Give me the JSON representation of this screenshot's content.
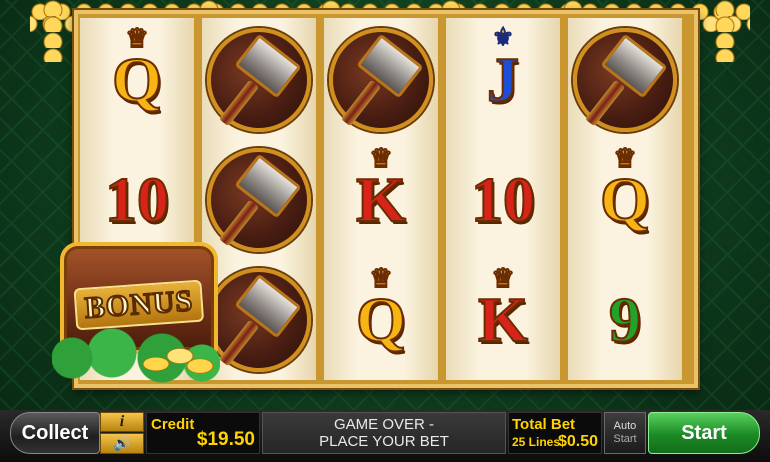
{
  "reels": [
    [
      {
        "type": "letter",
        "text": "Q",
        "color": "gold",
        "accent": "crown"
      },
      {
        "type": "letter",
        "text": "10",
        "color": "red",
        "accent": ""
      },
      {
        "type": "blank"
      }
    ],
    [
      {
        "type": "hammer"
      },
      {
        "type": "hammer"
      },
      {
        "type": "hammer"
      }
    ],
    [
      {
        "type": "hammer"
      },
      {
        "type": "letter",
        "text": "K",
        "color": "red",
        "accent": "crown"
      },
      {
        "type": "letter",
        "text": "Q",
        "color": "gold",
        "accent": "crown"
      }
    ],
    [
      {
        "type": "letter",
        "text": "J",
        "color": "blue",
        "accent": "fleur"
      },
      {
        "type": "letter",
        "text": "10",
        "color": "red",
        "accent": ""
      },
      {
        "type": "letter",
        "text": "K",
        "color": "red",
        "accent": "crown"
      }
    ],
    [
      {
        "type": "hammer"
      },
      {
        "type": "letter",
        "text": "Q",
        "color": "gold",
        "accent": "crown"
      },
      {
        "type": "letter",
        "text": "9",
        "color": "green",
        "accent": ""
      }
    ]
  ],
  "bonus": {
    "label": "BONUS"
  },
  "controls": {
    "collect_label": "Collect",
    "info_label": "i",
    "sound_icon": "speaker-icon",
    "credit_label": "Credit",
    "credit_value": "$19.50",
    "message_line1": "GAME OVER -",
    "message_line2": "PLACE YOUR BET",
    "total_bet_label": "Total Bet",
    "lines_label": "25 Lines",
    "total_bet_value": "$0.50",
    "auto_label": "Auto",
    "auto_start_label": "Start",
    "start_label": "Start"
  }
}
